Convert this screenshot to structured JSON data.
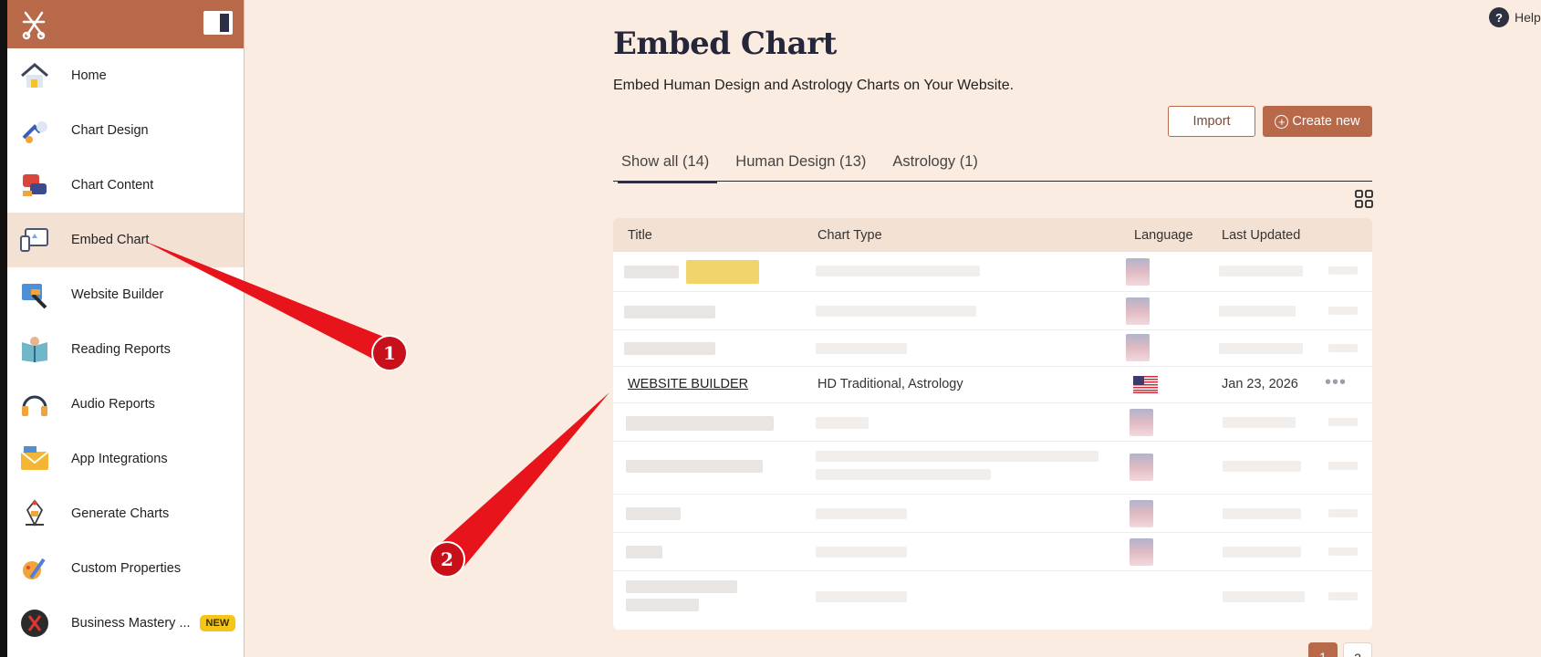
{
  "sidebar": {
    "items": [
      {
        "label": "Home",
        "icon": "home-icon"
      },
      {
        "label": "Chart Design",
        "icon": "chart-design-icon"
      },
      {
        "label": "Chart Content",
        "icon": "chart-content-icon"
      },
      {
        "label": "Embed Chart",
        "icon": "embed-chart-icon",
        "active": true
      },
      {
        "label": "Website Builder",
        "icon": "website-builder-icon"
      },
      {
        "label": "Reading Reports",
        "icon": "reading-reports-icon"
      },
      {
        "label": "Audio Reports",
        "icon": "headphones-icon"
      },
      {
        "label": "App Integrations",
        "icon": "envelope-icon"
      },
      {
        "label": "Generate Charts",
        "icon": "bodygraph-icon"
      },
      {
        "label": "Custom Properties",
        "icon": "custom-properties-icon"
      },
      {
        "label": "Business Mastery ...",
        "icon": "business-mastery-icon",
        "badge": "NEW"
      }
    ]
  },
  "help": {
    "label": "Help"
  },
  "page": {
    "title": "Embed Chart",
    "subtitle": "Embed Human Design and Astrology Charts on Your Website."
  },
  "actions": {
    "import": "Import",
    "create": "Create new"
  },
  "tabs": [
    {
      "label": "Show all (14)",
      "active": true
    },
    {
      "label": "Human Design (13)"
    },
    {
      "label": "Astrology (1)"
    }
  ],
  "table": {
    "headers": [
      "Title",
      "Chart Type",
      "Language",
      "Last Updated"
    ],
    "visible_row": {
      "title": "WEBSITE BUILDER",
      "chart_type": "HD Traditional, Astrology",
      "date": "Jan 23, 2026",
      "more": "•••"
    }
  },
  "pagination": {
    "pages": [
      "1",
      "2"
    ],
    "current": "1"
  },
  "annotations": {
    "marker1": "1",
    "marker2": "2"
  },
  "colors": {
    "brand": "#b8694a",
    "background": "#fbece1",
    "annotation": "#e8141c"
  }
}
